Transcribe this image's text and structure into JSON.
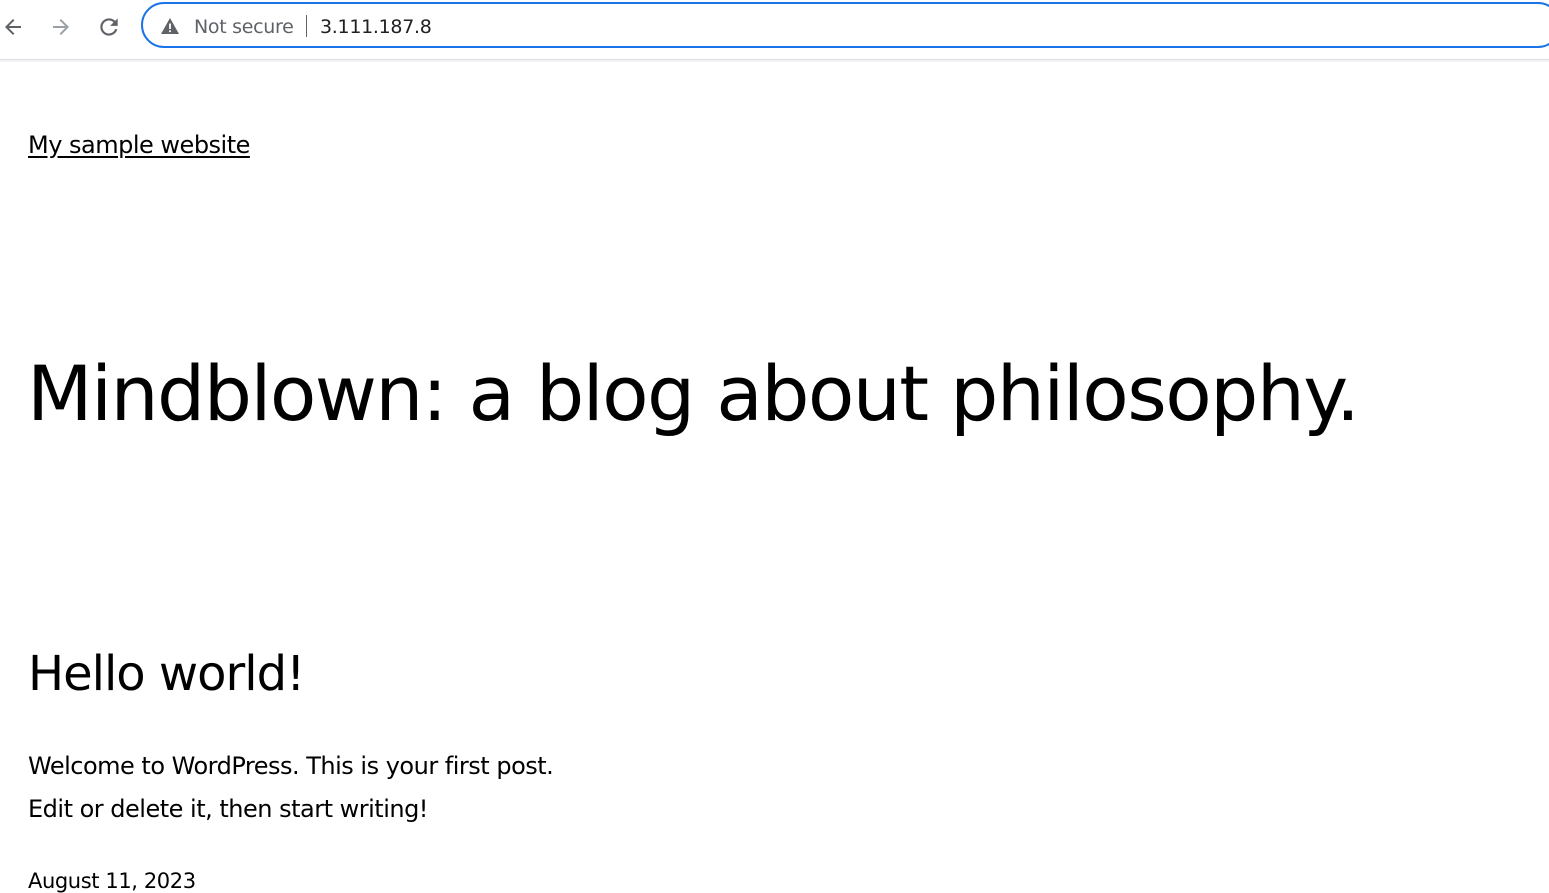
{
  "browser": {
    "back_icon": "arrow-left-icon",
    "forward_icon": "arrow-right-icon",
    "reload_icon": "reload-icon",
    "security_icon": "warning-triangle-icon",
    "security_label": "Not secure",
    "url": "3.111.187.8",
    "accent_color": "#1a73e8"
  },
  "site": {
    "title": "My sample website",
    "heading": "Mindblown: a blog about philosophy."
  },
  "post": {
    "title": "Hello world!",
    "body_line_1": "Welcome to WordPress. This is your first post.",
    "body_line_2": "Edit or delete it, then start writing!",
    "date": "August 11, 2023"
  }
}
